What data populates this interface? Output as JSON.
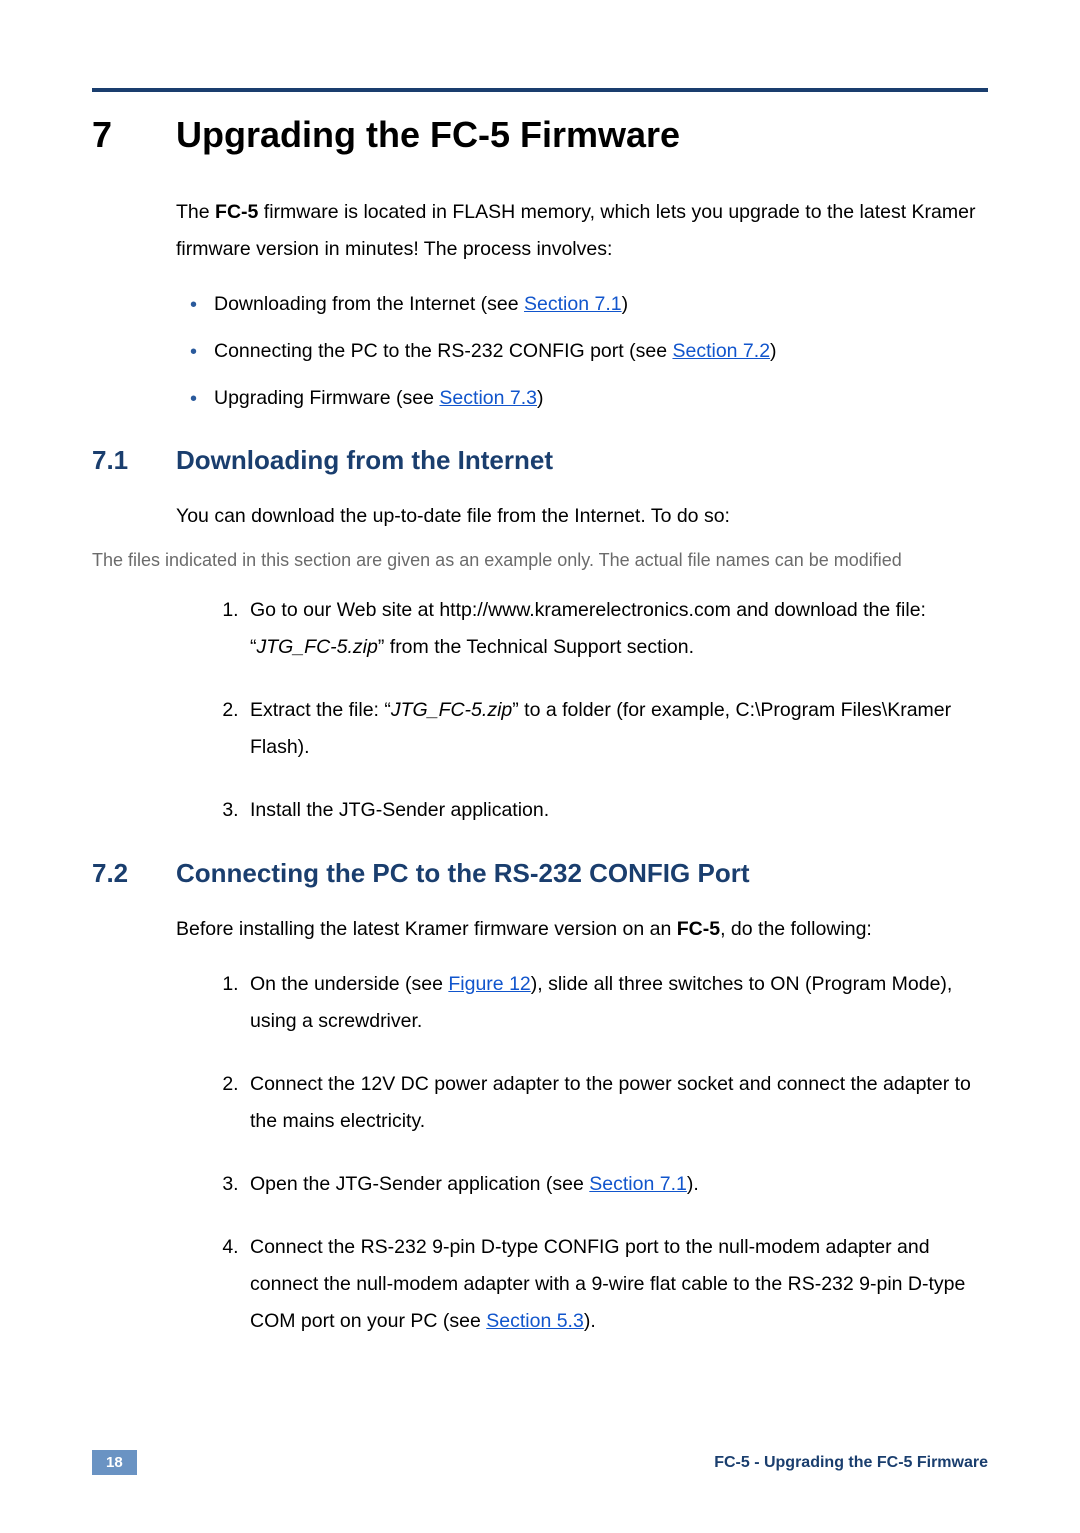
{
  "section": {
    "number": "7",
    "title": "Upgrading the FC-5 Firmware"
  },
  "intro": {
    "prefix": "The ",
    "model": "FC-5",
    "rest": " firmware is located in FLASH memory, which lets you upgrade to the latest Kramer firmware version in minutes! The process involves:"
  },
  "bullets": [
    {
      "text": "Downloading from the Internet (see ",
      "link": "Section 7.1",
      "suffix": ")"
    },
    {
      "text": "Connecting the PC to the RS-232 CONFIG port (see ",
      "link": "Section 7.2",
      "suffix": ")"
    },
    {
      "text": "Upgrading Firmware (see ",
      "link": "Section 7.3",
      "suffix": ")"
    }
  ],
  "sub1": {
    "number": "7.1",
    "title": "Downloading from the Internet",
    "intro": "You can download the up-to-date file from the Internet. To do so:",
    "note": "The files indicated in this section are given as an example only. The actual file names can be modified",
    "steps": [
      {
        "pre": "Go to our Web site at http://www.kramerelectronics.com and download the file: “",
        "italic": "JTG_FC-5.zip",
        "post": "” from the Technical Support section."
      },
      {
        "pre": "Extract the file: “",
        "italic": "JTG_FC-5.zip",
        "post": "” to a folder (for example, C:\\Program Files\\Kramer Flash)."
      },
      {
        "pre": "Install the JTG-Sender application.",
        "italic": "",
        "post": ""
      }
    ]
  },
  "sub2": {
    "number": "7.2",
    "title": "Connecting the PC to the RS-232 CONFIG Port",
    "intro_pre": "Before installing the latest Kramer firmware version on an ",
    "intro_bold": "FC-5",
    "intro_post": ", do the following:",
    "steps": [
      {
        "pre": "On the underside (see ",
        "link": "Figure 12",
        "post": "), slide all three switches to ON (Program Mode), using a screwdriver."
      },
      {
        "pre": "Connect the 12V DC power adapter to the power socket and connect the adapter to the mains electricity.",
        "link": "",
        "post": ""
      },
      {
        "pre": "Open the JTG-Sender application (see ",
        "link": "Section 7.1",
        "post": ")."
      },
      {
        "pre": "Connect the RS-232 9-pin D-type CONFIG port to the null-modem adapter and connect the null-modem adapter with a 9-wire flat cable to the RS-232 9-pin D-type COM port on your PC (see ",
        "link": "Section 5.3",
        "post": ")."
      }
    ]
  },
  "footer": {
    "page": "18",
    "title": "FC-5 - Upgrading the FC-5 Firmware"
  }
}
